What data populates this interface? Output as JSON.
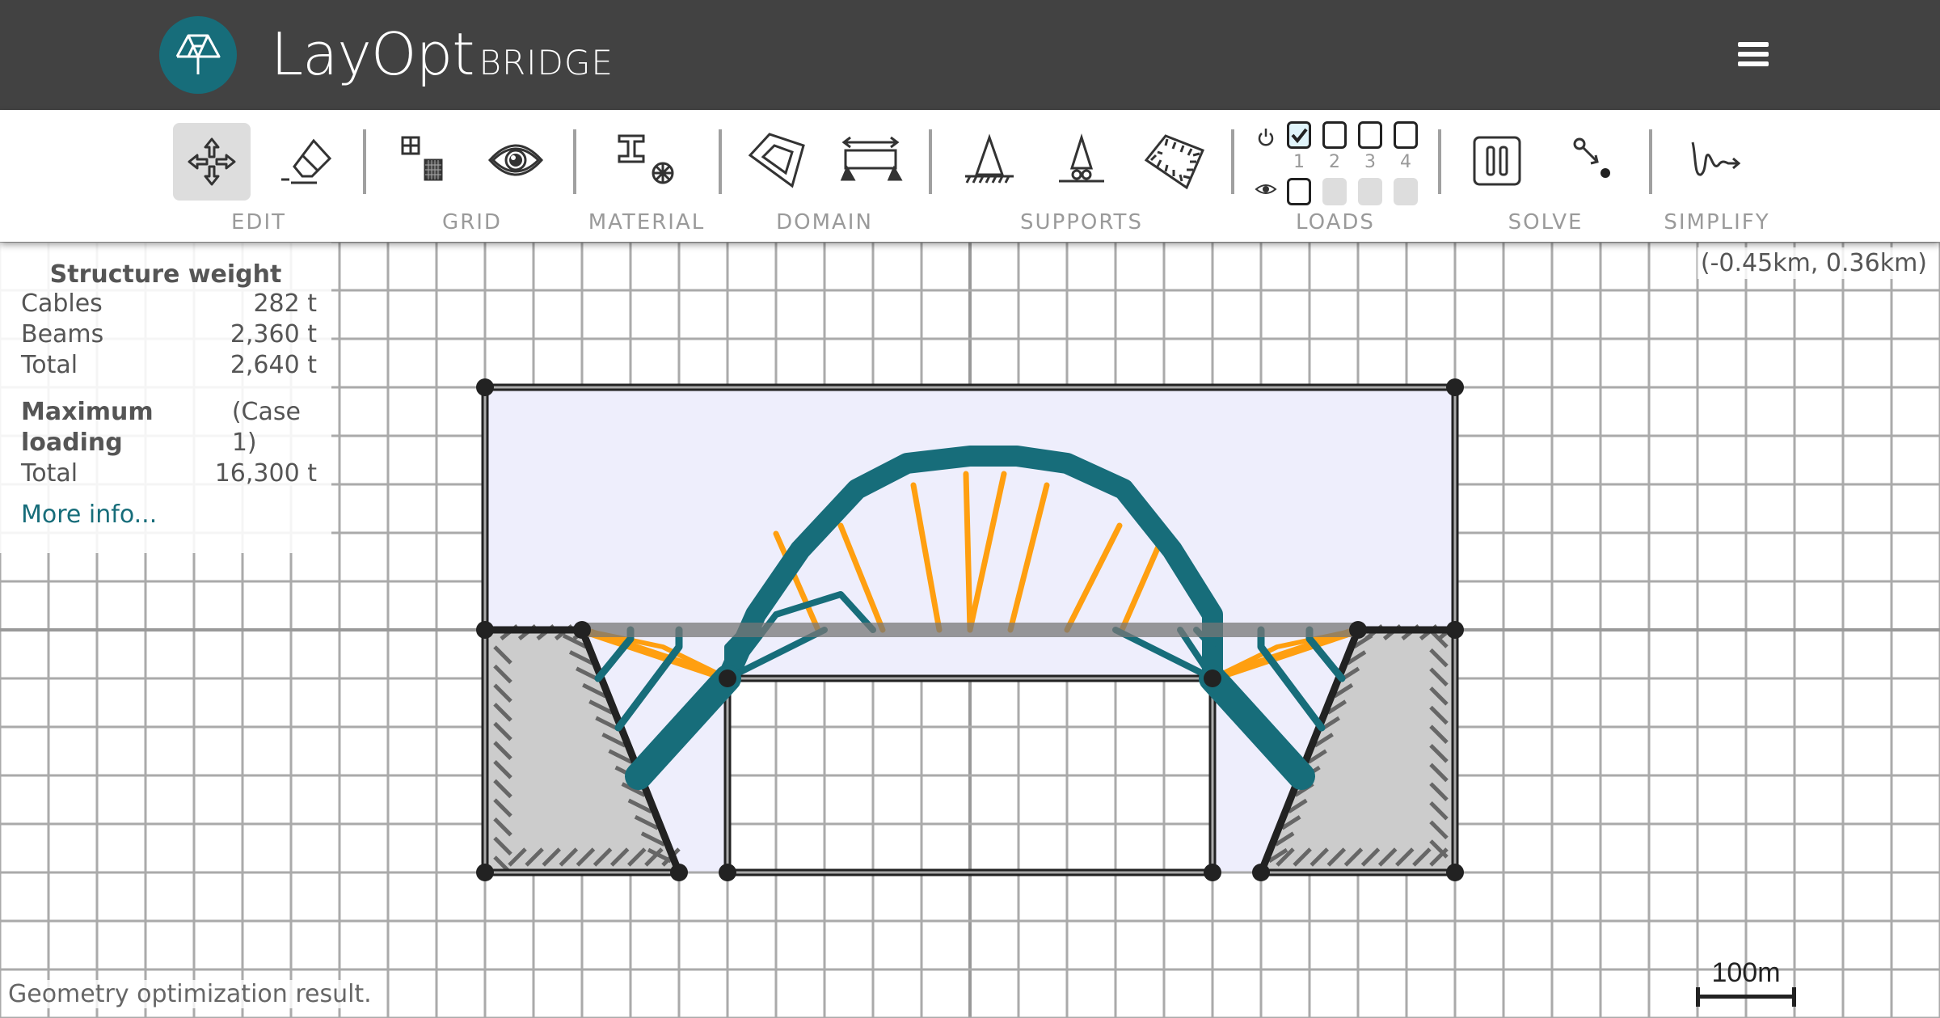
{
  "app": {
    "title": "LayOpt",
    "subtitle": "BRIDGE",
    "menu_icon": "hamburger-icon"
  },
  "toolbar": {
    "groups": [
      {
        "label": "EDIT",
        "buttons": [
          {
            "name": "move",
            "icon": "move-arrows-icon",
            "active": true
          },
          {
            "name": "erase",
            "icon": "eraser-icon",
            "active": false
          }
        ]
      },
      {
        "label": "GRID",
        "buttons": [
          {
            "name": "grid-density",
            "icon": "grid-icon"
          },
          {
            "name": "grid-visibility",
            "icon": "eye-icon"
          }
        ]
      },
      {
        "label": "MATERIAL",
        "buttons": [
          {
            "name": "material",
            "icon": "i-beam-cable-icon"
          }
        ]
      },
      {
        "label": "DOMAIN",
        "buttons": [
          {
            "name": "domain-shape",
            "icon": "polygon-domain-icon"
          },
          {
            "name": "span",
            "icon": "span-width-icon"
          }
        ]
      },
      {
        "label": "SUPPORTS",
        "buttons": [
          {
            "name": "pin-support",
            "icon": "pin-support-icon"
          },
          {
            "name": "roller-support",
            "icon": "roller-support-icon"
          },
          {
            "name": "fixed-region",
            "icon": "fixed-region-icon"
          }
        ]
      },
      {
        "label": "LOADS",
        "cases": [
          "1",
          "2",
          "3",
          "4"
        ],
        "active_checked": [
          true,
          false,
          false,
          false
        ],
        "visible_checked": [
          false
        ],
        "visible_disabled": [
          false,
          true,
          true,
          true
        ]
      },
      {
        "label": "SOLVE",
        "buttons": [
          {
            "name": "pause",
            "icon": "pause-icon"
          },
          {
            "name": "geometry-optimize",
            "icon": "node-move-icon"
          }
        ]
      },
      {
        "label": "SIMPLIFY",
        "buttons": [
          {
            "name": "simplify",
            "icon": "squiggle-arrow-icon"
          }
        ]
      }
    ]
  },
  "info_panel": {
    "weight_heading": "Structure weight",
    "rows": [
      {
        "label": "Cables",
        "value": "282 t"
      },
      {
        "label": "Beams",
        "value": "2,360 t"
      },
      {
        "label": "Total",
        "value": "2,640 t"
      }
    ],
    "loading_heading": "Maximum loading",
    "loading_case": "(Case 1)",
    "loading_rows": [
      {
        "label": "Total",
        "value": "16,300 t"
      }
    ],
    "more_info": "More info..."
  },
  "coords": "(-0.45km, 0.36km)",
  "status": "Geometry optimization result.",
  "scale_bar": "100m",
  "colors": {
    "header": "#424242",
    "accent": "#176d7a",
    "compression": "#176d7a",
    "tension": "#ff9f10",
    "domain_fill": "#eeeefc",
    "support_fill": "#cccccc"
  }
}
